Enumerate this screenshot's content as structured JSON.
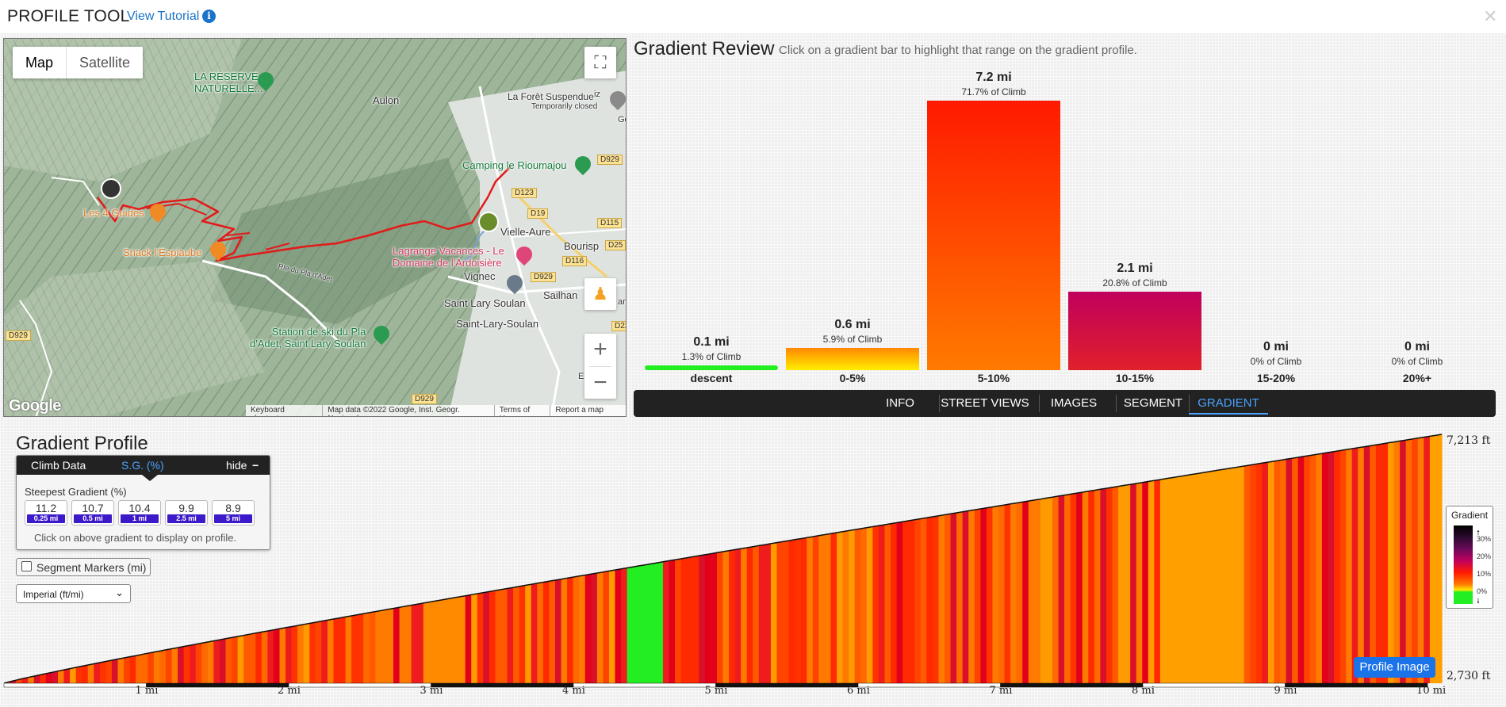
{
  "header": {
    "title": "PROFILE TOOL",
    "tutorial_link": "View Tutorial",
    "info_glyph": "i"
  },
  "map": {
    "map_button": "Map",
    "satellite_button": "Satellite",
    "labels": {
      "reserve": "LA RÉSERVE\nNATURELLE...",
      "aulon": "Aulon",
      "foret": "La Forêt Suspendue",
      "foret_sub": "Temporarily closed",
      "camping": "Camping le Rioumajou",
      "guides": "Les 4 Guides",
      "snack": "Snack l'Espiaube",
      "vielle": "Vielle-Aure",
      "bourisp": "Bourisp",
      "lagrange": "Lagrange Vacances - Le\nDomaine de l'Ardoisière",
      "vignec": "Vignec",
      "sailhan": "Sailhan",
      "saintlary1": "Saint Lary Soulan",
      "saintlary2": "Saint-Lary-Soulan",
      "station": "Station de ski du Pla\nd'Adet, Saint Lary Soulan",
      "road_label": "Rte du Pla d'Adet",
      "edge_e": "E",
      "edge_ar": "ar",
      "edge_iz": "iz",
      "edge_ge": "Ge"
    },
    "shields": [
      "D929",
      "D123",
      "D19",
      "D115",
      "D25",
      "D116",
      "D929",
      "D929",
      "D929",
      "D22"
    ],
    "footer": [
      "Keyboard shortcuts",
      "Map data ©2022 Google, Inst. Geogr. Nacional",
      "Terms of Use",
      "Report a map error"
    ],
    "google_logo": "Google",
    "zoom_in": "+",
    "zoom_out": "−"
  },
  "gradient_review": {
    "title": "Gradient Review",
    "subtitle": "Click on a gradient bar to highlight that range on the gradient profile."
  },
  "chart_data": {
    "type": "bar",
    "categories": [
      "descent",
      "0-5%",
      "5-10%",
      "10-15%",
      "15-20%",
      "20%+"
    ],
    "values": [
      0.1,
      0.6,
      7.2,
      2.1,
      0,
      0
    ],
    "value_labels": [
      "0.1 mi",
      "0.6 mi",
      "7.2 mi",
      "2.1 mi",
      "0 mi",
      "0 mi"
    ],
    "pct_labels": [
      "1.3% of Climb",
      "5.9% of Climb",
      "71.7% of Climb",
      "20.8% of Climb",
      "0% of Climb",
      "0% of Climb"
    ],
    "percent_of_climb": [
      1.3,
      5.9,
      71.7,
      20.8,
      0,
      0
    ],
    "colors": [
      "#22ee22",
      "#ffcc00",
      "#ff3300",
      "#d10042",
      "#6b0a5a",
      "#000000"
    ],
    "ylim": [
      0,
      7.2
    ]
  },
  "tabs": [
    {
      "label": "INFO",
      "active": false
    },
    {
      "label": "STREET VIEWS",
      "active": false
    },
    {
      "label": "IMAGES",
      "active": false
    },
    {
      "label": "SEGMENT",
      "active": false
    },
    {
      "label": "GRADIENT",
      "active": true
    }
  ],
  "gradient_profile": {
    "title": "Gradient Profile",
    "climb_tab": "Climb Data",
    "sg_tab": "S.G. (%)",
    "hide_label": "hide",
    "hide_glyph": "−",
    "steepest_label": "Steepest Gradient (%)",
    "steepest": [
      {
        "value": "11.2",
        "dist": "0.25 mi"
      },
      {
        "value": "10.7",
        "dist": "0.5 mi"
      },
      {
        "value": "10.4",
        "dist": "1 mi"
      },
      {
        "value": "9.9",
        "dist": "2.5 mi"
      },
      {
        "value": "8.9",
        "dist": "5 mi"
      }
    ],
    "click_note": "Click on above gradient to display on profile.",
    "segment_markers": "Segment Markers (mi)",
    "units_select": "Imperial (ft/mi)",
    "y_max": "7,213 ft",
    "y_min": "2,730 ft",
    "x_ticks": [
      "1 mi",
      "2 mi",
      "3 mi",
      "4 mi",
      "5 mi",
      "6 mi",
      "7 mi",
      "8 mi",
      "9 mi",
      "10 mi"
    ],
    "legend_title": "Gradient",
    "legend_ticks": [
      "30%",
      "20%",
      "10%",
      "0%"
    ],
    "profile_image_button": "Profile Image"
  }
}
